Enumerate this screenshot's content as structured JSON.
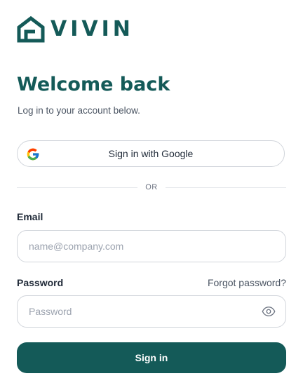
{
  "brand": {
    "name": "VIVIN",
    "logo_icon": "house-icon",
    "color": "#145a58"
  },
  "heading": {
    "title": "Welcome back",
    "subtitle": "Log in to your account below."
  },
  "google": {
    "label": "Sign in with Google",
    "icon": "google-icon"
  },
  "divider": {
    "text": "OR"
  },
  "email": {
    "label": "Email",
    "placeholder": "name@company.com",
    "value": ""
  },
  "password": {
    "label": "Password",
    "placeholder": "Password",
    "value": "",
    "forgot_label": "Forgot password?",
    "toggle_icon": "eye-icon"
  },
  "submit": {
    "label": "Sign in"
  },
  "colors": {
    "accent": "#145a58",
    "border": "#d1d5db",
    "muted": "#6b7280"
  }
}
